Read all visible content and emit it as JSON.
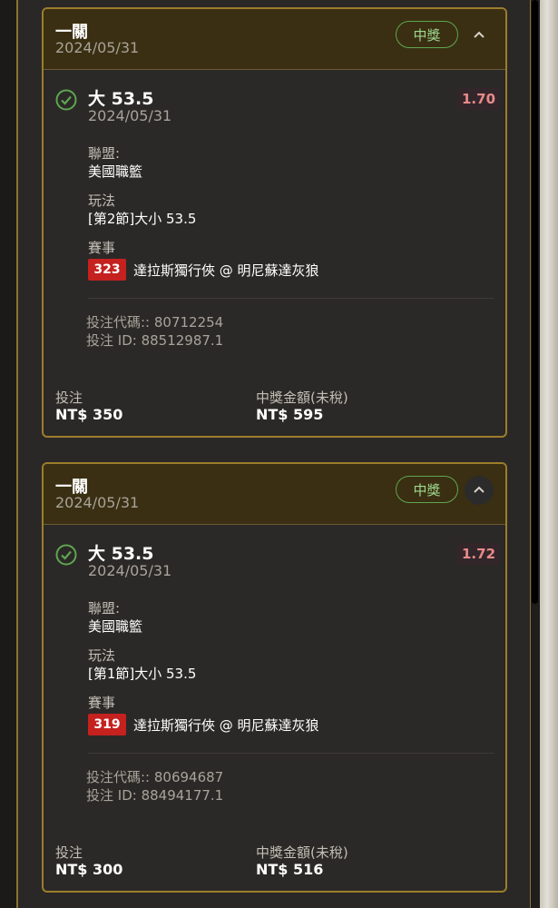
{
  "bets": [
    {
      "header_title": "一關",
      "header_date": "2024/05/31",
      "status": "中獎",
      "selection": "大 53.5",
      "selection_date": "2024/05/31",
      "odds": "1.70",
      "league_label": "聯盟:",
      "league": "美國職籃",
      "market_label": "玩法",
      "market": "[第2節]大小 53.5",
      "event_label": "賽事",
      "event_no": "323",
      "event_name": "達拉斯獨行俠 @ 明尼蘇達灰狼",
      "bet_code": "投注代碼:: 80712254",
      "bet_id": "投注 ID: 88512987.1",
      "stake_label": "投注",
      "stake": "NT$ 350",
      "payout_label": "中獎金額(未稅)",
      "payout": "NT$ 595"
    },
    {
      "header_title": "一關",
      "header_date": "2024/05/31",
      "status": "中獎",
      "selection": "大 53.5",
      "selection_date": "2024/05/31",
      "odds": "1.72",
      "league_label": "聯盟:",
      "league": "美國職籃",
      "market_label": "玩法",
      "market": "[第1節]大小 53.5",
      "event_label": "賽事",
      "event_no": "319",
      "event_name": "達拉斯獨行俠 @ 明尼蘇達灰狼",
      "bet_code": "投注代碼:: 80694687",
      "bet_id": "投注 ID: 88494177.1",
      "stake_label": "投注",
      "stake": "NT$ 300",
      "payout_label": "中獎金額(未稅)",
      "payout": "NT$ 516"
    }
  ],
  "icons": {
    "check": "check-circle-icon",
    "toggle": "chevron-up-icon"
  },
  "colors": {
    "card_border": "#9c7d2c",
    "header_bg": "#3a2f12",
    "win": "#5ea650",
    "odds": "#e88b8b",
    "event_badge": "#c4211f"
  }
}
